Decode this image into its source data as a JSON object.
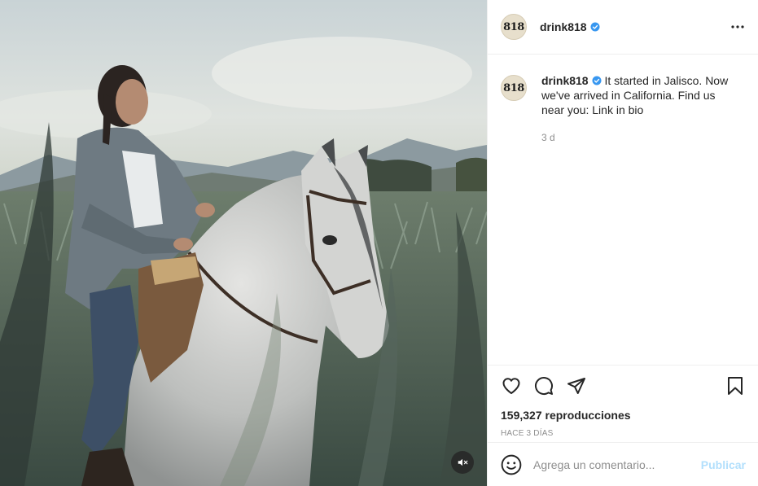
{
  "account": {
    "avatar_text": "818",
    "username": "drink818",
    "verified": true
  },
  "caption": {
    "text": "It started in Jalisco. Now we've arrived in California. Find us near you: Link in bio",
    "relative_time": "3 d"
  },
  "stats": {
    "views": "159,327 reproducciones",
    "posted_ago": "HACE 3 DÍAS"
  },
  "comment": {
    "placeholder": "Agrega un comentario...",
    "submit_label": "Publicar"
  },
  "colors": {
    "verified_blue": "#3897f0",
    "publish_disabled": "#b2dffc",
    "secondary_text": "#8e8e8e"
  },
  "icons": {
    "more": "more-options-icon",
    "like": "heart-icon",
    "comment": "comment-bubble-icon",
    "share": "paper-plane-icon",
    "save": "bookmark-icon",
    "emoji": "smiley-face-icon",
    "mute": "speaker-muted-icon"
  }
}
